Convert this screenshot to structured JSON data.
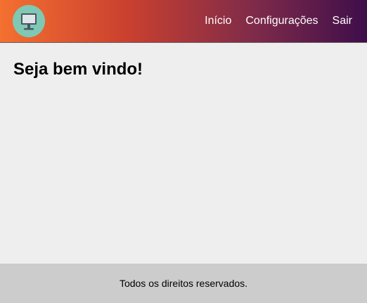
{
  "header": {
    "logo_icon": "monitor-icon",
    "colors": {
      "gradient_start": "#f47030",
      "gradient_end": "#3e0e4a",
      "logo_bg": "#7fc8b4"
    },
    "nav": [
      {
        "label": "Início"
      },
      {
        "label": "Configurações"
      },
      {
        "label": "Sair"
      }
    ]
  },
  "main": {
    "heading": "Seja bem vindo!"
  },
  "footer": {
    "text": "Todos os direitos reservados."
  }
}
